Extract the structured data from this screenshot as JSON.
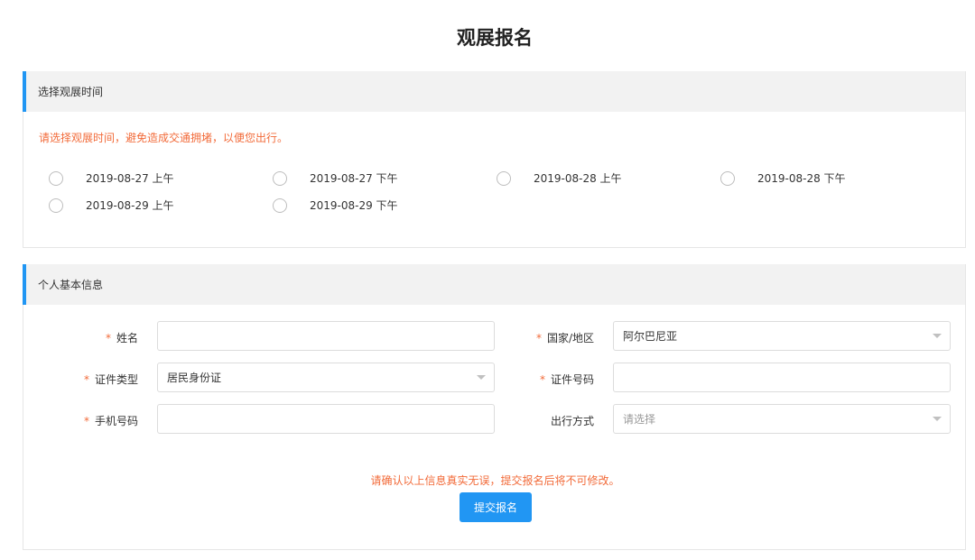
{
  "page": {
    "title": "观展报名"
  },
  "visit_time": {
    "header": "选择观展时间",
    "hint": "请选择观展时间，避免造成交通拥堵，以便您出行。",
    "options": [
      "2019-08-27 上午",
      "2019-08-27 下午",
      "2019-08-28 上午",
      "2019-08-28 下午",
      "2019-08-29 上午",
      "2019-08-29 下午"
    ]
  },
  "personal_info": {
    "header": "个人基本信息",
    "required_mark": "*",
    "name": {
      "label": "姓名",
      "value": ""
    },
    "country": {
      "label": "国家/地区",
      "value": "阿尔巴尼亚"
    },
    "id_type": {
      "label": "证件类型",
      "value": "居民身份证"
    },
    "id_number": {
      "label": "证件号码",
      "value": ""
    },
    "phone": {
      "label": "手机号码",
      "value": ""
    },
    "travel_mode": {
      "label": "出行方式",
      "placeholder": "请选择"
    },
    "confirm_text": "请确认以上信息真实无误，提交报名后将不可修改。",
    "submit_label": "提交报名"
  },
  "colors": {
    "accent": "#2196f3",
    "warning": "#f26b3a",
    "header_bg": "#f2f2f2"
  }
}
